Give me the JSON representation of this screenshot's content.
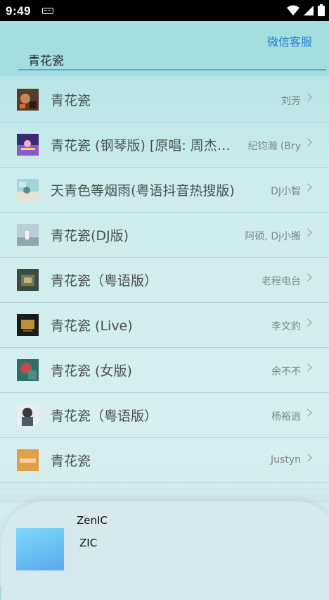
{
  "status_bar": {
    "time": "9:49"
  },
  "header": {
    "service_link": "微信客服",
    "search_value": "青花瓷"
  },
  "songs": [
    {
      "title": "青花瓷",
      "artist": "刘芳"
    },
    {
      "title": "青花瓷 (钢琴版) [原唱: 周杰伦]",
      "artist": "纪钧瀚 (Bry"
    },
    {
      "title": "天青色等烟雨(粤语抖音热搜版)",
      "artist": "DJ小智"
    },
    {
      "title": "青花瓷(DJ版)",
      "artist": "阿硕, Dj小搬"
    },
    {
      "title": "青花瓷（粤语版）",
      "artist": "老程电台"
    },
    {
      "title": "青花瓷 (Live)",
      "artist": "李文豹"
    },
    {
      "title": "青花瓷 (女版)",
      "artist": "余不不"
    },
    {
      "title": "青花瓷（粤语版）",
      "artist": "杨裕逍"
    },
    {
      "title": "青花瓷",
      "artist": "Justyn"
    }
  ],
  "player": {
    "title": "ZenIC",
    "artist": "ZIC"
  }
}
